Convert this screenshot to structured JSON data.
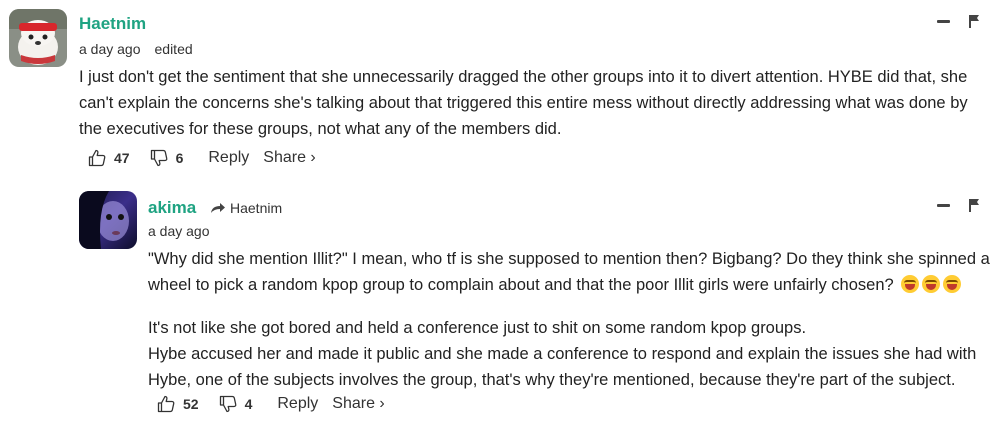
{
  "comments": [
    {
      "username": "Haetnim",
      "timestamp": "a day ago",
      "edited_label": "edited",
      "body": [
        "I just don't get the sentiment that she unnecessarily dragged the other groups into it to divert attention. HYBE did that, she can't explain the concerns she's talking about that triggered this entire mess without directly addressing what was done by the executives for these groups, not what any of the members did."
      ],
      "upvotes": "47",
      "downvotes": "6",
      "reply_label": "Reply",
      "share_label": "Share ›"
    },
    {
      "username": "akima",
      "reply_to": "Haetnim",
      "timestamp": "a day ago",
      "body": [
        "\"Why did she mention Illit?\" I mean, who tf is she supposed to mention then? Bigbang? Do they think she spinned a wheel to pick a random kpop group to complain about and that the poor Illit girls were unfairly chosen?",
        "It's not like she got bored and held a conference just to shit on some random kpop groups.\nHybe accused her and made it public and she made a conference to respond and explain the issues she had with Hybe, one of the subjects involves the group, that's why they're mentioned, because they're part of the subject."
      ],
      "emojis": [
        "laughing-tears-emoji",
        "laughing-tears-emoji",
        "laughing-tears-emoji"
      ],
      "upvotes": "52",
      "downvotes": "4",
      "reply_label": "Reply",
      "share_label": "Share ›"
    }
  ],
  "colors": {
    "username": "#1fa382",
    "text": "#222222",
    "muted": "#333333"
  }
}
